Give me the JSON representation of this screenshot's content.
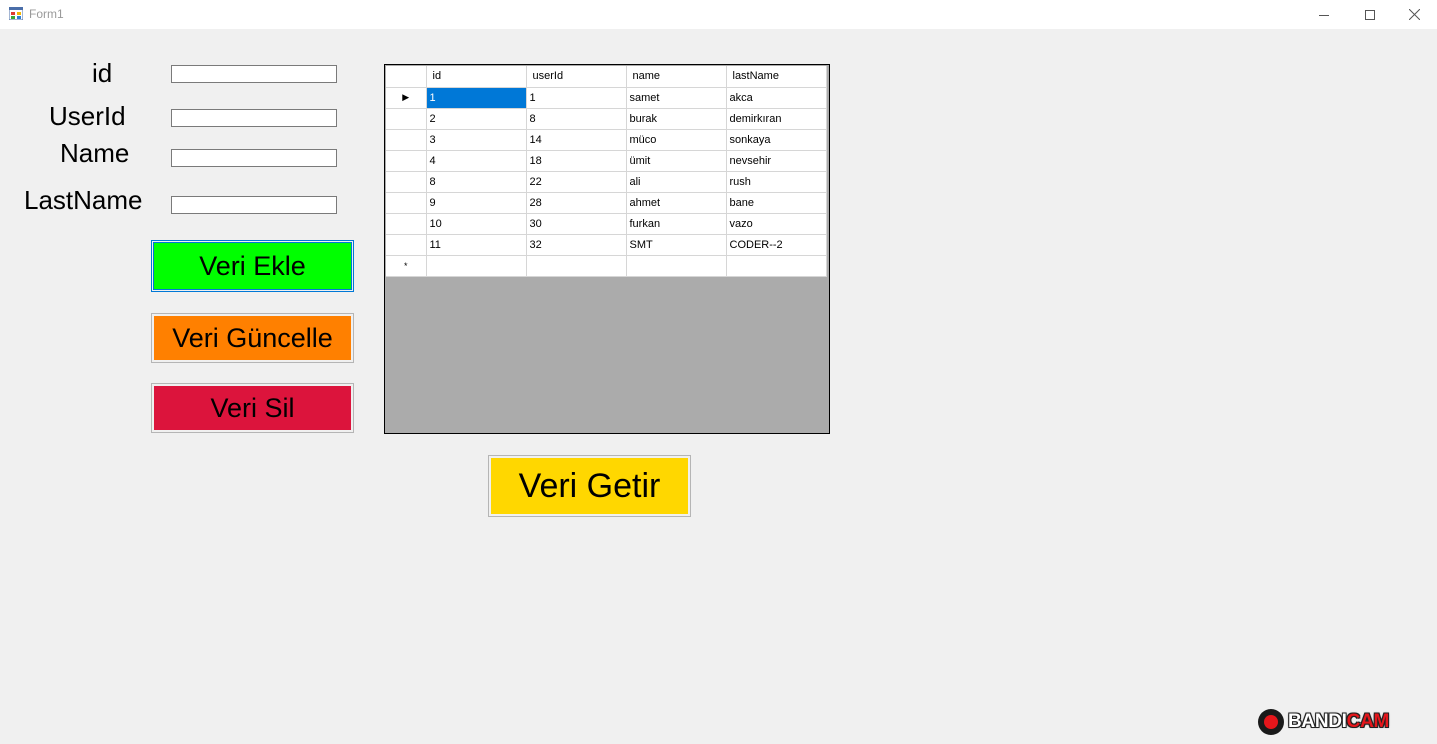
{
  "window": {
    "title": "Form1",
    "controls": {
      "minimize_icon": "minimize-icon",
      "maximize_icon": "maximize-icon",
      "close_icon": "close-icon"
    }
  },
  "form": {
    "labels": {
      "id": "id",
      "userId": "UserId",
      "name": "Name",
      "lastName": "LastName"
    },
    "inputs": {
      "id": "",
      "userId": "",
      "name": "",
      "lastName": ""
    }
  },
  "buttons": {
    "add": {
      "label": "Veri Ekle",
      "color": "#00ff00"
    },
    "update": {
      "label": "Veri Güncelle",
      "color": "#ff8000"
    },
    "delete": {
      "label": "Veri Sil",
      "color": "#dc143c"
    },
    "fetch": {
      "label": "Veri Getir",
      "color": "#ffd700"
    }
  },
  "grid": {
    "columns": [
      "id",
      "userId",
      "name",
      "lastName"
    ],
    "rows": [
      [
        "1",
        "1",
        "samet",
        "akca"
      ],
      [
        "2",
        "8",
        "burak",
        "demirkıran"
      ],
      [
        "3",
        "14",
        "müco",
        "sonkaya"
      ],
      [
        "4",
        "18",
        "ümit",
        "nevsehir"
      ],
      [
        "8",
        "22",
        "ali",
        "rush"
      ],
      [
        "9",
        "28",
        "ahmet",
        "bane"
      ],
      [
        "10",
        "30",
        "furkan",
        "vazo"
      ],
      [
        "11",
        "32",
        "SMT",
        "CODER--2"
      ]
    ],
    "selected_row": 0,
    "current_row_marker": "▶",
    "new_row_marker": "*",
    "selection_color": "#0078d7",
    "background_color": "#ababab"
  },
  "watermark": {
    "brand_prefix": "BANDI",
    "brand_suffix": "CAM"
  }
}
